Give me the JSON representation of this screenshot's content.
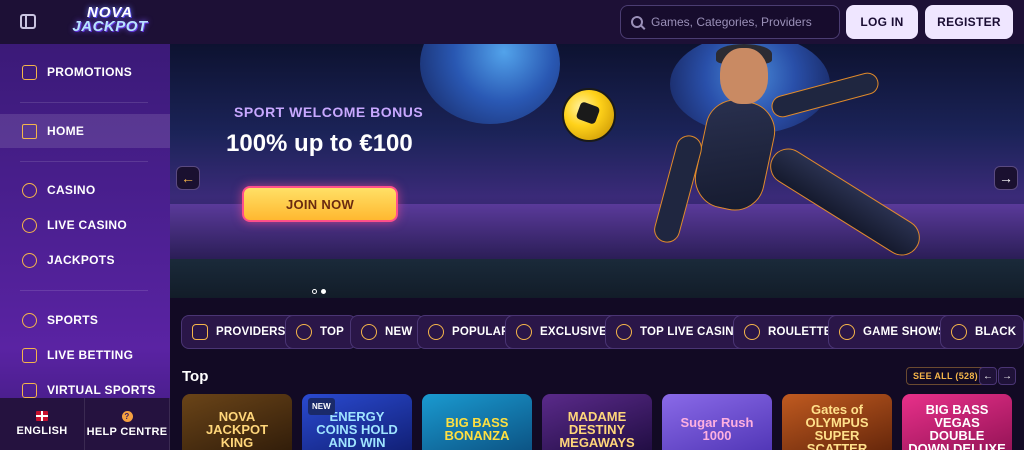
{
  "header": {
    "logo_line1": "NOVA",
    "logo_line2": "JACKPOT",
    "search_placeholder": "Games, Categories, Providers",
    "login_label": "LOG IN",
    "register_label": "REGISTER"
  },
  "sidebar": {
    "items": [
      {
        "label": "PROMOTIONS",
        "icon": "gift-icon"
      },
      {
        "label": "HOME",
        "icon": "home-icon",
        "active": true
      },
      {
        "label": "CASINO",
        "icon": "chip-icon"
      },
      {
        "label": "LIVE CASINO",
        "icon": "spade-icon"
      },
      {
        "label": "JACKPOTS",
        "icon": "seven-icon"
      },
      {
        "label": "SPORTS",
        "icon": "ball-icon"
      },
      {
        "label": "LIVE BETTING",
        "icon": "play-icon"
      },
      {
        "label": "VIRTUAL SPORTS",
        "icon": "gamepad-icon"
      }
    ],
    "footer": {
      "language_label": "ENGLISH",
      "help_label": "HELP CENTRE"
    }
  },
  "banner": {
    "subtitle": "SPORT WELCOME BONUS",
    "title": "100% up to €100",
    "cta_label": "JOIN NOW",
    "slide_count": 2,
    "active_slide": 2
  },
  "categories": [
    {
      "label": "PROVIDERS",
      "icon": "grid-icon"
    },
    {
      "label": "TOP",
      "icon": "medal-icon"
    },
    {
      "label": "NEW",
      "icon": "rocket-icon"
    },
    {
      "label": "POPULAR",
      "icon": "flame-icon"
    },
    {
      "label": "EXCLUSIVE",
      "icon": "diamond-icon"
    },
    {
      "label": "TOP LIVE CASINO",
      "icon": "star-icon"
    },
    {
      "label": "ROULETTE",
      "icon": "roulette-icon"
    },
    {
      "label": "GAME SHOWS",
      "icon": "wheel-icon"
    },
    {
      "label": "BLACK",
      "icon": "spade-icon"
    }
  ],
  "top_section": {
    "title": "Top",
    "see_all_label": "SEE ALL (528)",
    "prev_icon": "←",
    "next_icon": "→"
  },
  "games": [
    {
      "title": "NOVA JACKPOT KING",
      "badge": "",
      "bg": "#3a2410"
    },
    {
      "title": "ENERGY COINS HOLD AND WIN",
      "badge": "NEW",
      "bg": "#1a2f8a"
    },
    {
      "title": "BIG BASS BONANZA",
      "badge": "",
      "bg": "#0d6a9a"
    },
    {
      "title": "MADAME DESTINY MEGAWAYS",
      "badge": "",
      "bg": "#3a1a5a"
    },
    {
      "title": "Sugar Rush 1000",
      "badge": "",
      "bg": "#6a4ad0"
    },
    {
      "title": "Gates of OLYMPUS SUPER SCATTER",
      "badge": "",
      "bg": "#7a3a1a"
    },
    {
      "title": "BIG BASS VEGAS DOUBLE DOWN DELUXE",
      "badge": "",
      "bg": "#b8206a"
    }
  ],
  "colors": {
    "accent": "#f5b54a",
    "header_bg": "#1d1036",
    "page_bg": "#120a24",
    "chip_bg": "#2a1648"
  }
}
